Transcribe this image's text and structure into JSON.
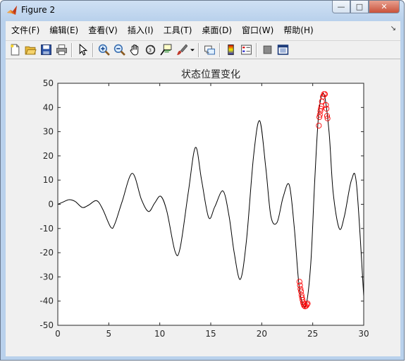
{
  "window": {
    "title": "Figure 2",
    "buttons": {
      "minimize": "—",
      "maximize": "□",
      "close": "✕"
    }
  },
  "menubar": {
    "items": [
      "文件(F)",
      "编辑(E)",
      "查看(V)",
      "插入(I)",
      "工具(T)",
      "桌面(D)",
      "窗口(W)",
      "帮助(H)"
    ]
  },
  "toolbar": {
    "icons": [
      "new-figure-icon",
      "open-file-icon",
      "save-icon",
      "print-icon",
      "edit-plot-arrow-icon",
      "zoom-in-icon",
      "zoom-out-icon",
      "pan-hand-icon",
      "rotate-3d-icon",
      "data-cursor-icon",
      "brush-icon",
      "brush-dropdown-icon",
      "link-plot-icon",
      "insert-colorbar-icon",
      "insert-legend-icon",
      "hide-plot-tools-icon",
      "show-plot-tools-icon"
    ]
  },
  "chart_data": {
    "type": "line",
    "title": "状态位置变化",
    "xlabel": "",
    "ylabel": "",
    "xlim": [
      0,
      30
    ],
    "ylim": [
      -50,
      50
    ],
    "xticks": [
      0,
      5,
      10,
      15,
      20,
      25,
      30
    ],
    "yticks": [
      -50,
      -40,
      -30,
      -20,
      -10,
      0,
      10,
      20,
      30,
      40,
      50
    ],
    "grid": false,
    "series": [
      {
        "style": "solid-black-line",
        "color": "#000000",
        "x": [
          0,
          0.5,
          1.1,
          1.7,
          2.4,
          3.0,
          3.8,
          4.4,
          5.2,
          5.6,
          6.3,
          7.3,
          8.2,
          8.9,
          9.5,
          10.1,
          10.7,
          11.5,
          12.0,
          12.8,
          13.5,
          14.1,
          14.8,
          15.4,
          16.2,
          16.8,
          17.3,
          17.9,
          18.5,
          19.2,
          19.8,
          20.4,
          20.9,
          21.5,
          22.1,
          22.7,
          23.2,
          23.7,
          24.3,
          24.8,
          25.2,
          25.6,
          26.1,
          26.6,
          27.0,
          27.6,
          28.1,
          28.8,
          29.3,
          30.0
        ],
        "y": [
          0,
          0.9,
          1.9,
          1.2,
          -1.3,
          -0.4,
          1.5,
          -2.0,
          -9.5,
          -8.0,
          1.0,
          12.8,
          2.0,
          -3.0,
          0.5,
          3.3,
          -3.0,
          -19.5,
          -18.0,
          5.0,
          23.5,
          10.0,
          -5.5,
          -1.0,
          5.5,
          -5.0,
          -20.0,
          -31.0,
          -15.0,
          20.0,
          34.5,
          15.0,
          -5.0,
          -7.5,
          3.0,
          8.0,
          -10.0,
          -35.0,
          -42.0,
          -25.0,
          10.0,
          38.0,
          45.5,
          30.0,
          5.0,
          -10.0,
          -5.0,
          10.0,
          8.0,
          -38.0
        ]
      }
    ],
    "markers": {
      "style": "red-circle",
      "color": "#ff0000",
      "points": [
        [
          23.7,
          -32.0
        ],
        [
          23.75,
          -33.5
        ],
        [
          23.8,
          -35.0
        ],
        [
          23.85,
          -36.0
        ],
        [
          23.9,
          -37.5
        ],
        [
          23.95,
          -38.5
        ],
        [
          24.0,
          -39.5
        ],
        [
          24.05,
          -40.5
        ],
        [
          24.1,
          -41.2
        ],
        [
          24.15,
          -41.8
        ],
        [
          24.25,
          -42.2
        ],
        [
          24.35,
          -42.0
        ],
        [
          24.45,
          -41.4
        ],
        [
          24.5,
          -41.0
        ],
        [
          25.6,
          32.5
        ],
        [
          25.65,
          36.0
        ],
        [
          25.7,
          37.0
        ],
        [
          25.75,
          38.5
        ],
        [
          25.8,
          39.5
        ],
        [
          25.85,
          40.5
        ],
        [
          25.9,
          42.5
        ],
        [
          26.0,
          44.5
        ],
        [
          26.1,
          45.5
        ],
        [
          26.2,
          45.5
        ],
        [
          26.3,
          41.0
        ],
        [
          26.35,
          39.5
        ],
        [
          26.4,
          36.5
        ],
        [
          26.45,
          35.5
        ]
      ]
    }
  }
}
